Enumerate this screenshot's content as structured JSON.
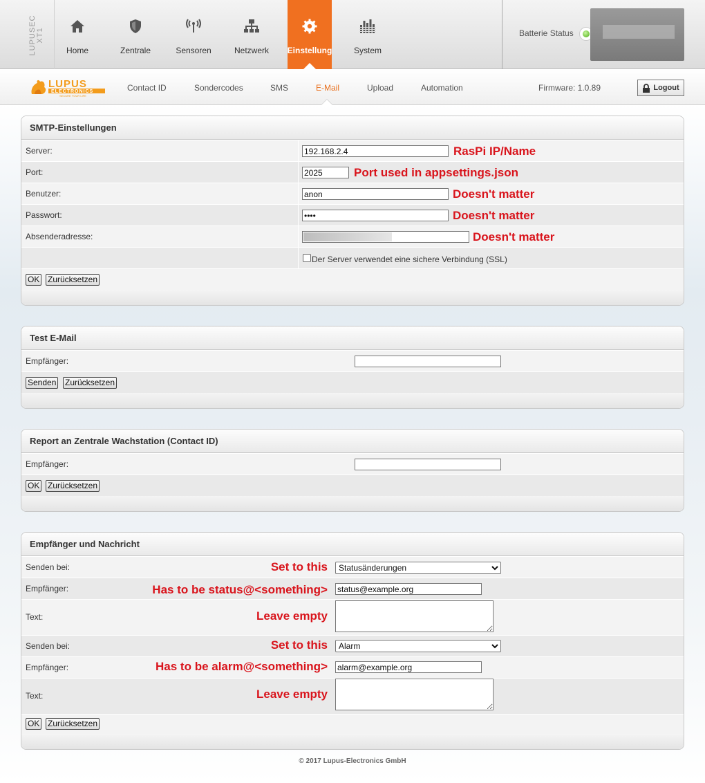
{
  "brand": {
    "vertical_text": "LUPUSEC\nXT1"
  },
  "nav": [
    {
      "label": "Home",
      "icon": "home-icon"
    },
    {
      "label": "Zentrale",
      "icon": "shield-icon"
    },
    {
      "label": "Sensoren",
      "icon": "antenna-icon"
    },
    {
      "label": "Netzwerk",
      "icon": "network-icon"
    },
    {
      "label": "Einstellung",
      "icon": "gear-icon",
      "active": true
    },
    {
      "label": "System",
      "icon": "equalizer-icon"
    }
  ],
  "battery": {
    "label": "Batterie Status",
    "led_color": "#4aaa10"
  },
  "subnav": [
    {
      "label": "Contact ID"
    },
    {
      "label": "Sondercodes"
    },
    {
      "label": "SMS"
    },
    {
      "label": "E-Mail",
      "active": true
    },
    {
      "label": "Upload"
    },
    {
      "label": "Automation"
    }
  ],
  "firmware": "Firmware: 1.0.89",
  "logout": {
    "label": "Logout",
    "icon": "lock-icon"
  },
  "accent_color": "#f07020",
  "annotation_color": "#d9141c",
  "smtp": {
    "title": "SMTP-Einstellungen",
    "server_label": "Server:",
    "server_value": "192.168.2.4",
    "server_note": "RasPi IP/Name",
    "port_label": "Port:",
    "port_value": "2025",
    "port_note": "Port used in appsettings.json",
    "user_label": "Benutzer:",
    "user_value": "anon",
    "user_note": "Doesn't matter",
    "password_label": "Passwort:",
    "password_value": "••••",
    "password_note": "Doesn't matter",
    "sender_label": "Absenderadresse:",
    "sender_note": "Doesn't matter",
    "ssl_label": "Der Server verwendet eine sichere Verbindung (SSL)",
    "ok_label": "OK",
    "reset_label": "Zurücksetzen"
  },
  "test": {
    "title": "Test E-Mail",
    "recipient_label": "Empfänger:",
    "recipient_value": "",
    "send_label": "Senden",
    "reset_label": "Zurücksetzen"
  },
  "report": {
    "title": "Report an Zentrale Wachstation (Contact ID)",
    "recipient_label": "Empfänger:",
    "recipient_value": "",
    "ok_label": "OK",
    "reset_label": "Zurücksetzen"
  },
  "messages": {
    "title": "Empfänger und Nachricht",
    "send_on_label": "Senden bei:",
    "recipient_label": "Empfänger:",
    "text_label": "Text:",
    "entry1": {
      "send_on_value": "Statusänderungen",
      "send_on_note": "Set to this",
      "recipient_value": "status@example.org",
      "recipient_note": "Has to be status@<something>",
      "text_note": "Leave empty"
    },
    "entry2": {
      "send_on_value": "Alarm",
      "send_on_note": "Set to this",
      "recipient_value": "alarm@example.org",
      "recipient_note": "Has to be alarm@<something>",
      "text_note": "Leave empty"
    },
    "ok_label": "OK",
    "reset_label": "Zurücksetzen"
  },
  "footer": "© 2017 Lupus-Electronics GmbH"
}
